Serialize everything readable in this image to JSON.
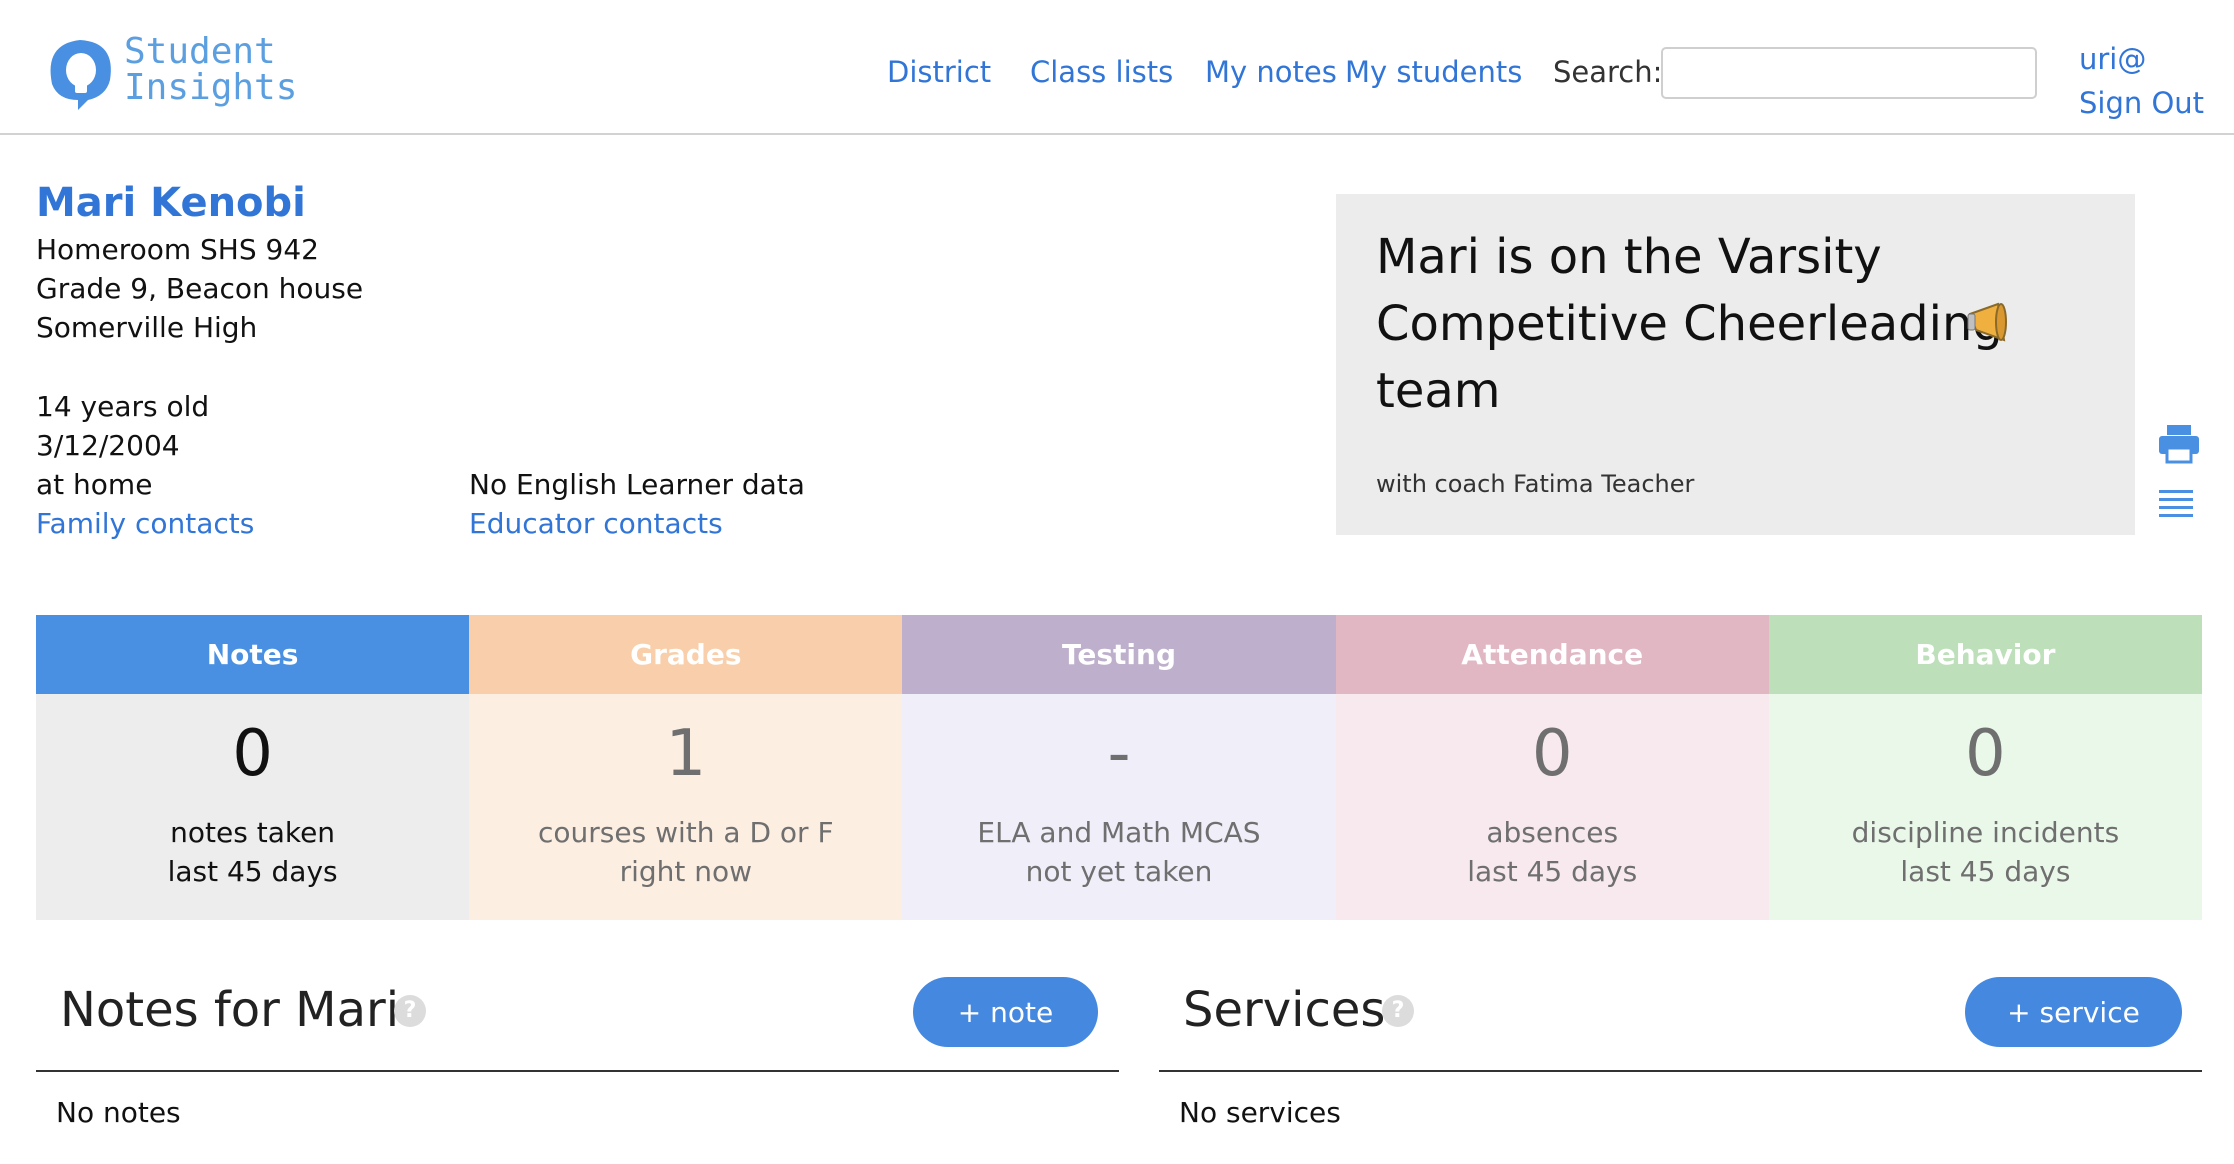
{
  "header": {
    "logo_line1": "Student",
    "logo_line2": "Insights",
    "nav": [
      "District",
      "Class lists",
      "My notes",
      "My students"
    ],
    "search_label": "Search:",
    "search_value": "",
    "user": "uri@",
    "sign_out": "Sign Out"
  },
  "student": {
    "name": "Mari Kenobi",
    "homeroom": "Homeroom SHS 942",
    "grade_house": "Grade 9, Beacon house",
    "school": "Somerville High",
    "age": "14 years old",
    "birthdate": "3/12/2004",
    "living": "at home",
    "family_contacts": "Family contacts",
    "ell": "No English Learner data",
    "educator_contacts": "Educator contacts"
  },
  "highlight": {
    "text": "Mari is on the Varsity Competitive Cheerleading team",
    "coach": "with coach Fatima Teacher"
  },
  "tiles": [
    {
      "label": "Notes",
      "value": "0",
      "line1": "notes taken",
      "line2": "last 45 days",
      "head_color": "#4a90e2",
      "body_color": "#ededed",
      "text_color": "#111111"
    },
    {
      "label": "Grades",
      "value": "1",
      "line1": "courses with a D or F",
      "line2": "right now",
      "head_color": "#f8cfaa",
      "body_color": "#fdeee2",
      "text_color": "#6f6f6f"
    },
    {
      "label": "Testing",
      "value": "-",
      "line1": "ELA and Math MCAS",
      "line2": "not yet taken",
      "head_color": "#beafcc",
      "body_color": "#efeef9",
      "text_color": "#6f6f6f"
    },
    {
      "label": "Attendance",
      "value": "0",
      "line1": "absences",
      "line2": "last 45 days",
      "head_color": "#e1b7c4",
      "body_color": "#f7e9ee",
      "text_color": "#6f6f6f"
    },
    {
      "label": "Behavior",
      "value": "0",
      "line1": "discipline incidents",
      "line2": "last 45 days",
      "head_color": "#bde0ba",
      "body_color": "#eaf8ea",
      "text_color": "#6f6f6f"
    }
  ],
  "notes_section": {
    "title": "Notes for Mari",
    "add_button": "+ note",
    "empty": "No notes"
  },
  "services_section": {
    "title": "Services",
    "add_button": "+ service",
    "empty": "No services"
  },
  "icons": {
    "logo": "lightbulb-icon",
    "print": "print-icon",
    "list": "list-icon",
    "highlight": "megaphone-icon",
    "help": "help-icon"
  }
}
